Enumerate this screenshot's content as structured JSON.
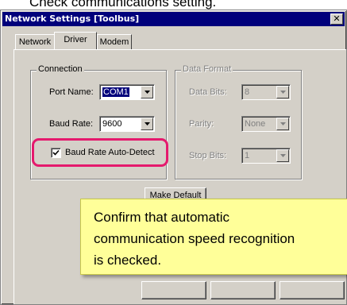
{
  "caption": "Check communications setting.",
  "window": {
    "title": "Network Settings [Toolbus]",
    "close_glyph": "✕"
  },
  "tabs": [
    {
      "label": "Network",
      "active": false
    },
    {
      "label": "Driver",
      "active": true
    },
    {
      "label": "Modem",
      "active": false
    }
  ],
  "connection": {
    "title": "Connection",
    "port_name_label": "Port Name:",
    "port_name_value": "COM1",
    "baud_rate_label": "Baud Rate:",
    "baud_rate_value": "9600",
    "auto_detect_label": "Baud Rate Auto-Detect",
    "auto_detect_checked": true
  },
  "data_format": {
    "title": "Data Format",
    "data_bits_label": "Data Bits:",
    "data_bits_value": "8",
    "parity_label": "Parity:",
    "parity_value": "None",
    "stop_bits_label": "Stop Bits:",
    "stop_bits_value": "1"
  },
  "buttons": {
    "make_default": "Make Default"
  },
  "callout": {
    "line1": "Confirm that automatic",
    "line2": "communication speed recognition",
    "line3": "is checked."
  },
  "colors": {
    "titlebar": "#00007b",
    "highlight": "#e5196d",
    "callout_bg": "#ffff99"
  }
}
